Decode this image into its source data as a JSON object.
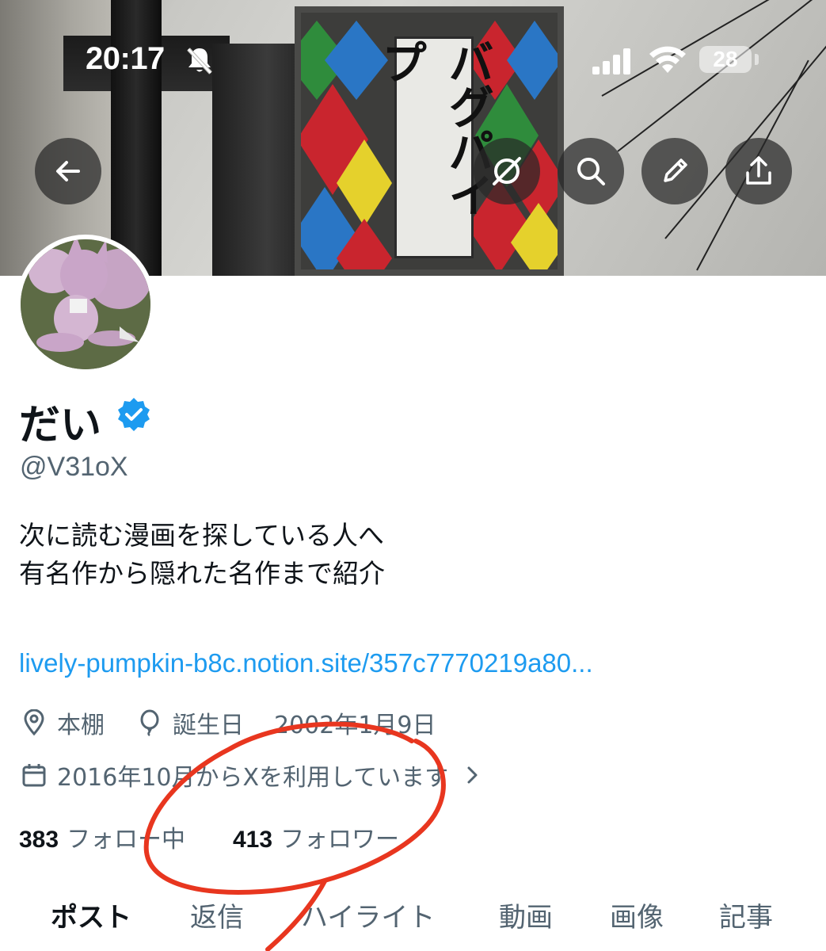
{
  "status_bar": {
    "time": "20:17",
    "battery": "28",
    "icons": [
      "bell-muted-icon",
      "signal-icon",
      "wifi-icon",
      "battery-icon"
    ]
  },
  "banner": {
    "sign_text": "バグパイプ"
  },
  "top_actions": {
    "icons": [
      "back-arrow-icon",
      "grok-icon",
      "search-icon",
      "edit-icon",
      "share-icon"
    ]
  },
  "profile": {
    "display_name": "だい",
    "handle": "@V31oX",
    "verified": true,
    "bio_line1": "次に読む漫画を探している人へ",
    "bio_line2": "有名作から隠れた名作まで紹介",
    "link": "lively-pumpkin-b8c.notion.site/357c7770219a80...",
    "location": "本棚",
    "birthday_label": "誕生日",
    "birthday": "2002年1月9日",
    "joined": "2016年10月からXを利用しています"
  },
  "stats": {
    "following_count": "383",
    "following_label": "フォロー中",
    "followers_count": "413",
    "followers_label": "フォロワー"
  },
  "tabs": [
    {
      "label": "ポスト",
      "active": true
    },
    {
      "label": "返信",
      "active": false
    },
    {
      "label": "ハイライト",
      "active": false
    },
    {
      "label": "動画",
      "active": false
    },
    {
      "label": "画像",
      "active": false
    },
    {
      "label": "記事",
      "active": false
    }
  ],
  "colors": {
    "link": "#1d9bf0",
    "verified": "#1d9bf0",
    "secondary_text": "#536471",
    "annotation": "#e8361f"
  }
}
